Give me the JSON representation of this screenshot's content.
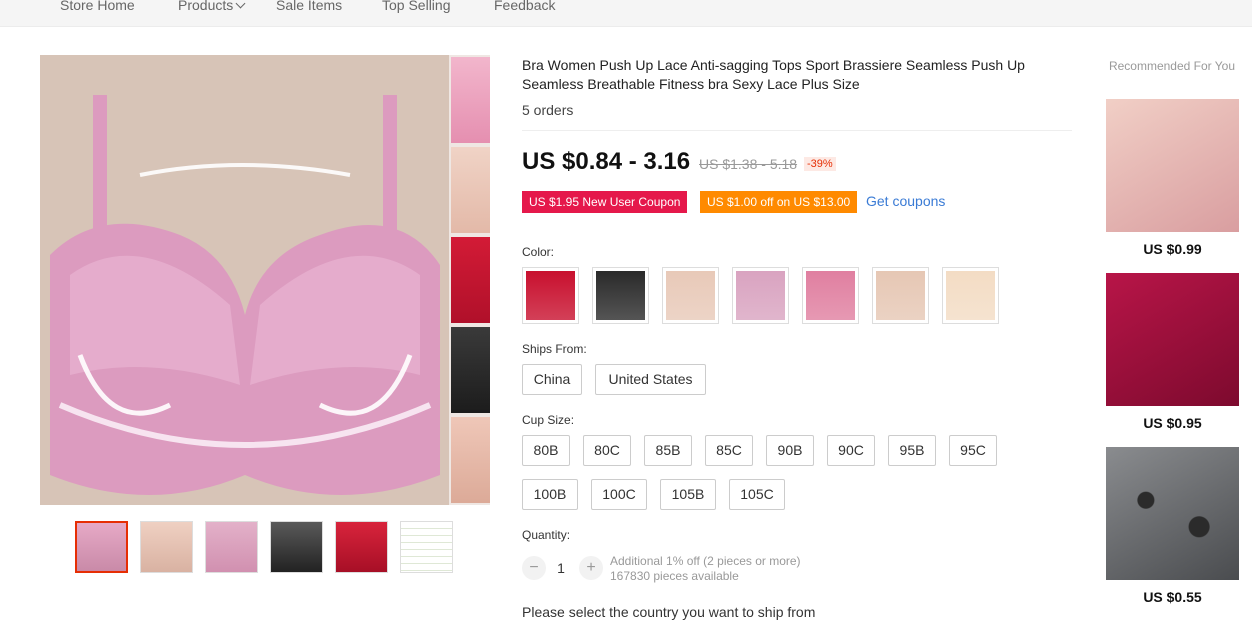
{
  "nav": {
    "items": [
      "Store Home",
      "Products",
      "Sale Items",
      "Top Selling",
      "Feedback"
    ]
  },
  "product": {
    "title": "Bra Women Push Up Lace Anti-sagging Tops Sport Brassiere Seamless Push Up Seamless Breathable Fitness bra Sexy Lace Plus Size",
    "orders": "5 orders",
    "price": "US $0.84 - 3.16",
    "old_price": "US $1.38 - 5.18",
    "discount": "-39%",
    "coupons": [
      "US $1.95 New User Coupon",
      "US $1.00 off on US $13.00"
    ],
    "get_coupons": "Get coupons",
    "color_label": "Color:",
    "colors": [
      "#c8102e",
      "#2a2a2a",
      "#e8c9b8",
      "#d9a3c0",
      "#e07fa0",
      "#e6c7b4",
      "#f3dcc4"
    ],
    "ships_from_label": "Ships From:",
    "ships_from": [
      "China",
      "United States"
    ],
    "cup_size_label": "Cup Size:",
    "cup_sizes": [
      "80B",
      "80C",
      "85B",
      "85C",
      "90B",
      "90C",
      "95B",
      "95C",
      "100B",
      "100C",
      "105B",
      "105C"
    ],
    "quantity_label": "Quantity:",
    "quantity": "1",
    "qty_minus": "−",
    "qty_plus": "+",
    "qty_note_1": "Additional 1% off (2 pieces or more)",
    "qty_note_2": "167830 pieces available",
    "ship_note": "Please select the country you want to ship from"
  },
  "recommended": {
    "title": "Recommended For You",
    "items": [
      {
        "price": "US $0.99",
        "color": "#e8b9b3"
      },
      {
        "price": "US $0.95",
        "color": "#a3103f"
      },
      {
        "price": "US $0.55",
        "color": "#5b5d60"
      }
    ]
  }
}
